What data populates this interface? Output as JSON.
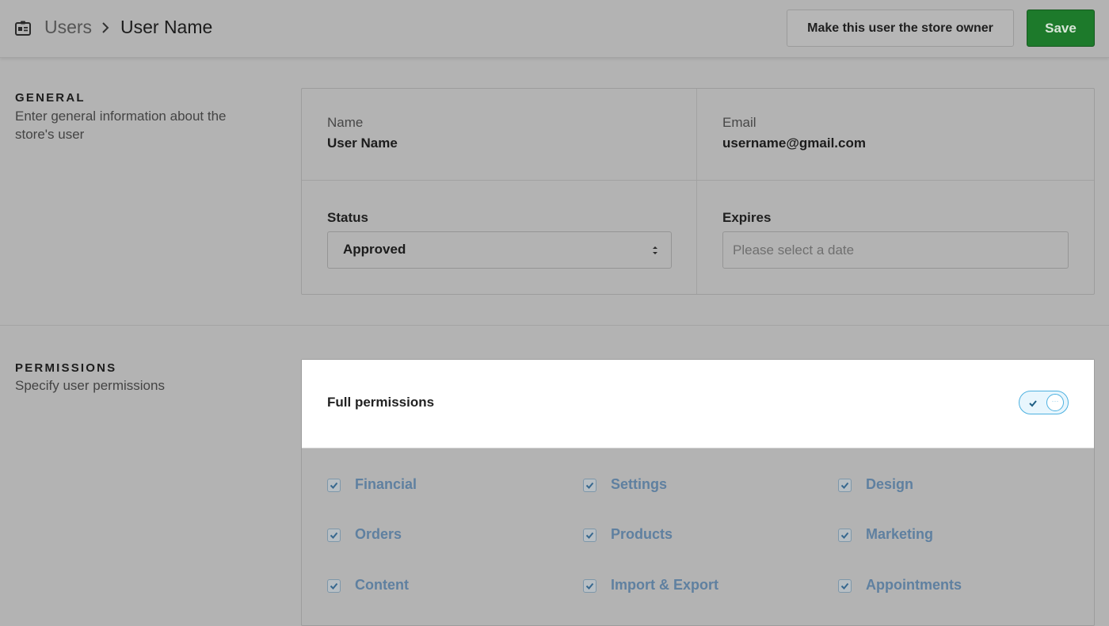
{
  "header": {
    "breadcrumb_icon": "user-badge-icon",
    "breadcrumb_parent": "Users",
    "breadcrumb_separator_icon": "chevron-right-icon",
    "breadcrumb_current": "User Name",
    "owner_button_label": "Make this user the store owner",
    "save_button_label": "Save"
  },
  "general": {
    "title": "GENERAL",
    "description": "Enter general information about the store's user",
    "name_label": "Name",
    "name_value": "User Name",
    "email_label": "Email",
    "email_value": "username@gmail.com",
    "status_label": "Status",
    "status_value": "Approved",
    "expires_label": "Expires",
    "expires_placeholder": "Please select a date",
    "expires_value": ""
  },
  "permissions": {
    "title": "PERMISSIONS",
    "description": "Specify user permissions",
    "full_label": "Full permissions",
    "full_enabled": true,
    "items": [
      {
        "label": "Financial",
        "checked": true
      },
      {
        "label": "Settings",
        "checked": true
      },
      {
        "label": "Design",
        "checked": true
      },
      {
        "label": "Orders",
        "checked": true
      },
      {
        "label": "Products",
        "checked": true
      },
      {
        "label": "Marketing",
        "checked": true
      },
      {
        "label": "Content",
        "checked": true
      },
      {
        "label": "Import & Export",
        "checked": true
      },
      {
        "label": "Appointments",
        "checked": true
      }
    ]
  },
  "colors": {
    "save_button": "#1d7a2b",
    "toggle_accent": "#4db1e0",
    "permission_text": "#5f80a0",
    "overlay_background": "#b3b3b3"
  }
}
